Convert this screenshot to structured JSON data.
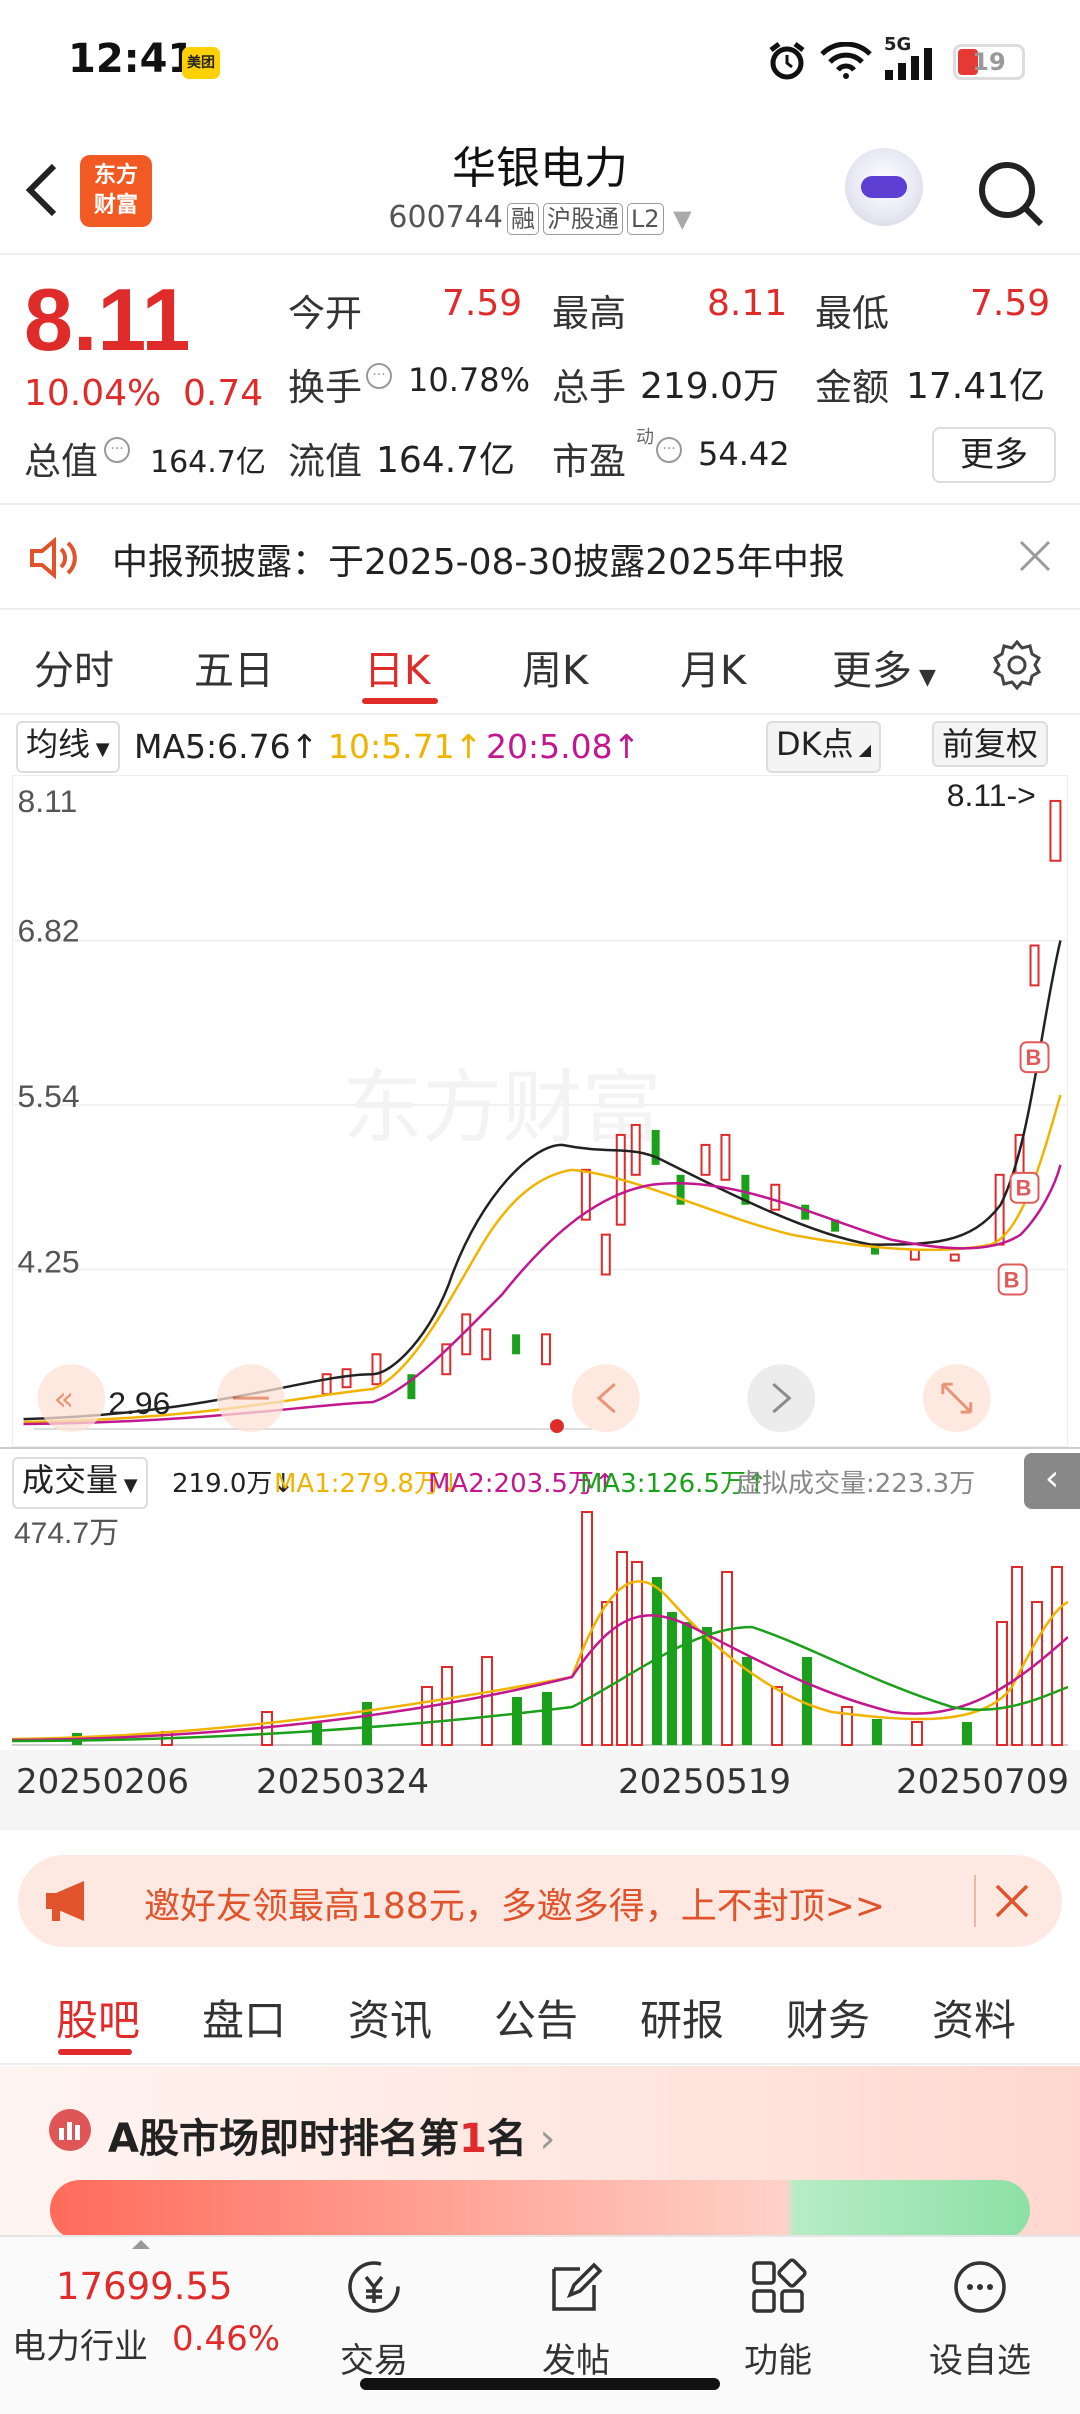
{
  "status_bar": {
    "time": "12:41",
    "app_badge": "美团",
    "network": "5G",
    "battery": "19"
  },
  "header": {
    "title": "华银电力",
    "logo_text": "东方财富",
    "code": "600744",
    "tags": [
      "融",
      "沪股通",
      "L2"
    ]
  },
  "quote": {
    "price": "8.11",
    "change_pct": "10.04%",
    "change_amt": "0.74",
    "fields": [
      {
        "label": "今开",
        "value": "7.59"
      },
      {
        "label": "最高",
        "value": "8.11"
      },
      {
        "label": "最低",
        "value": "7.59"
      },
      {
        "label": "换手",
        "value": "10.78%"
      },
      {
        "label": "总手",
        "value": "219.0万"
      },
      {
        "label": "金额",
        "value": "17.41亿"
      },
      {
        "label": "总值",
        "value": "164.7亿"
      },
      {
        "label": "流值",
        "value": "164.7亿"
      },
      {
        "label": "市盈",
        "value": "54.42",
        "superscript": "动"
      }
    ],
    "more_label": "更多"
  },
  "notice": {
    "text": "中报预披露：于2025-08-30披露2025年中报"
  },
  "period_tabs": {
    "items": [
      "分时",
      "五日",
      "日K",
      "周K",
      "月K",
      "更多"
    ],
    "active": 2
  },
  "ma_bar": {
    "selector": "均线",
    "ma5": "MA5:6.76↑",
    "ma10": "10:5.71↑",
    "ma20": "20:5.08↑",
    "dk_label": "DK点",
    "adjust_label": "前复权",
    "colors": {
      "ma5": "#222222",
      "ma10": "#f0b400",
      "ma20": "#c2178f"
    }
  },
  "chart": {
    "y_labels": [
      "8.11",
      "6.82",
      "5.54",
      "4.25"
    ],
    "last_price_tag": "8.11->",
    "low_tag": "2.96",
    "watermark": "东方财富",
    "signal": "B"
  },
  "volume_bar": {
    "selector": "成交量",
    "vol": "219.0万↓",
    "ma1": "MA1:279.8万↓",
    "ma2": "MA2:203.5万↑",
    "ma3": "MA3:126.5万↑",
    "virtual": "虚拟成交量:223.3万",
    "max_label": "474.7万"
  },
  "dates": [
    "20250206",
    "20250324",
    "20250519",
    "20250709"
  ],
  "banner": {
    "text": "邀好友领最高188元，多邀多得，上不封顶>>"
  },
  "content_tabs": {
    "items": [
      "股吧",
      "盘口",
      "资讯",
      "公告",
      "研报",
      "财务",
      "资料"
    ],
    "active": 0
  },
  "rank": {
    "prefix": "A股市场即时排名第",
    "rank": "1",
    "suffix": "名"
  },
  "bottom_bar": {
    "index_value": "17699.55",
    "industry": "电力行业",
    "industry_pct": "0.46%",
    "items": [
      "交易",
      "发帖",
      "功能",
      "设自选"
    ]
  }
}
